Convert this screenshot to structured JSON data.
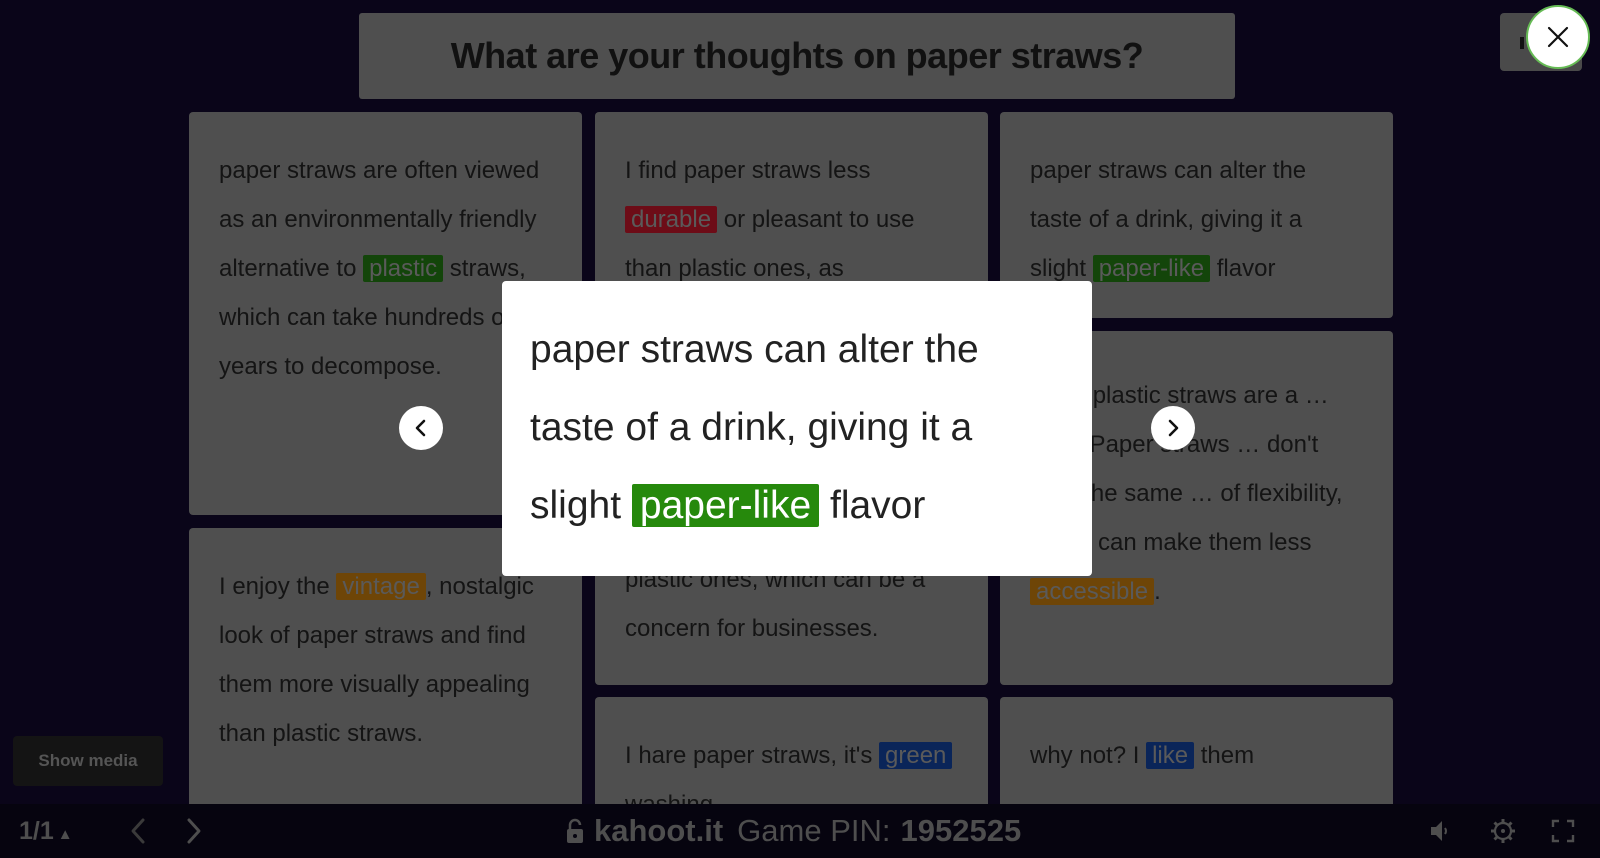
{
  "question": "What are your thoughts on paper straws?",
  "top_right_button": {
    "label": ""
  },
  "show_media": "Show media",
  "cards": [
    {
      "segments": [
        {
          "text": "paper straws are often viewed as an environmentally friendly alternative to "
        },
        {
          "text": "plastic",
          "highlight": "green"
        },
        {
          "text": " straws, which can take hundreds of years to decompose."
        }
      ]
    },
    {
      "segments": [
        {
          "text": "I find paper straws less "
        },
        {
          "text": "durable",
          "highlight": "red"
        },
        {
          "text": " or pleasant to use than plastic ones, as "
        }
      ]
    },
    {
      "segments": [
        {
          "text": "paper straws can alter the taste of a drink, giving it a slight "
        },
        {
          "text": "paper-like",
          "highlight": "green"
        },
        {
          "text": " flavor"
        }
      ]
    },
    {
      "segments": [
        {
          "text": "…ble plastic straws are a …ssity. Paper straws … don't offer the same … of flexibility, which can make them less "
        },
        {
          "text": "accessible",
          "highlight": "orange"
        },
        {
          "text": "."
        }
      ]
    },
    {
      "segments": [
        {
          "text": "plastic ones, which can be a concern for businesses."
        }
      ]
    },
    {
      "segments": [
        {
          "text": "I enjoy the "
        },
        {
          "text": "vintage",
          "highlight": "orange"
        },
        {
          "text": ", nostalgic look of paper straws and find them more visually appealing than plastic straws."
        }
      ]
    },
    {
      "segments": [
        {
          "text": "I hare paper straws, it's "
        },
        {
          "text": "green",
          "highlight": "blue"
        },
        {
          "text": " washing"
        }
      ]
    },
    {
      "segments": [
        {
          "text": "why not? I "
        },
        {
          "text": "like",
          "highlight": "blue"
        },
        {
          "text": " them"
        }
      ]
    }
  ],
  "modal": {
    "text_before": "paper straws can alter the taste of a drink, giving it a slight ",
    "highlight": "paper-like",
    "text_after": " flavor",
    "prev_icon": "chevron-left-icon",
    "next_icon": "chevron-right-icon",
    "close_icon": "close-icon"
  },
  "bottom_bar": {
    "counter": "1/1",
    "counter_caret": "▲",
    "site": "kahoot.it",
    "pin_label": "Game PIN:",
    "pin_value": "1952525",
    "icons": [
      "lock-icon",
      "chevron-left-icon",
      "chevron-right-icon",
      "volume-icon",
      "settings-icon",
      "fullscreen-icon"
    ]
  },
  "colors": {
    "background": "#0a0519",
    "highlight_green": "#26890c",
    "highlight_red": "#e21b3c",
    "highlight_orange": "#d89e00",
    "highlight_blue": "#1368ce",
    "close_ring": "#66bb55"
  }
}
